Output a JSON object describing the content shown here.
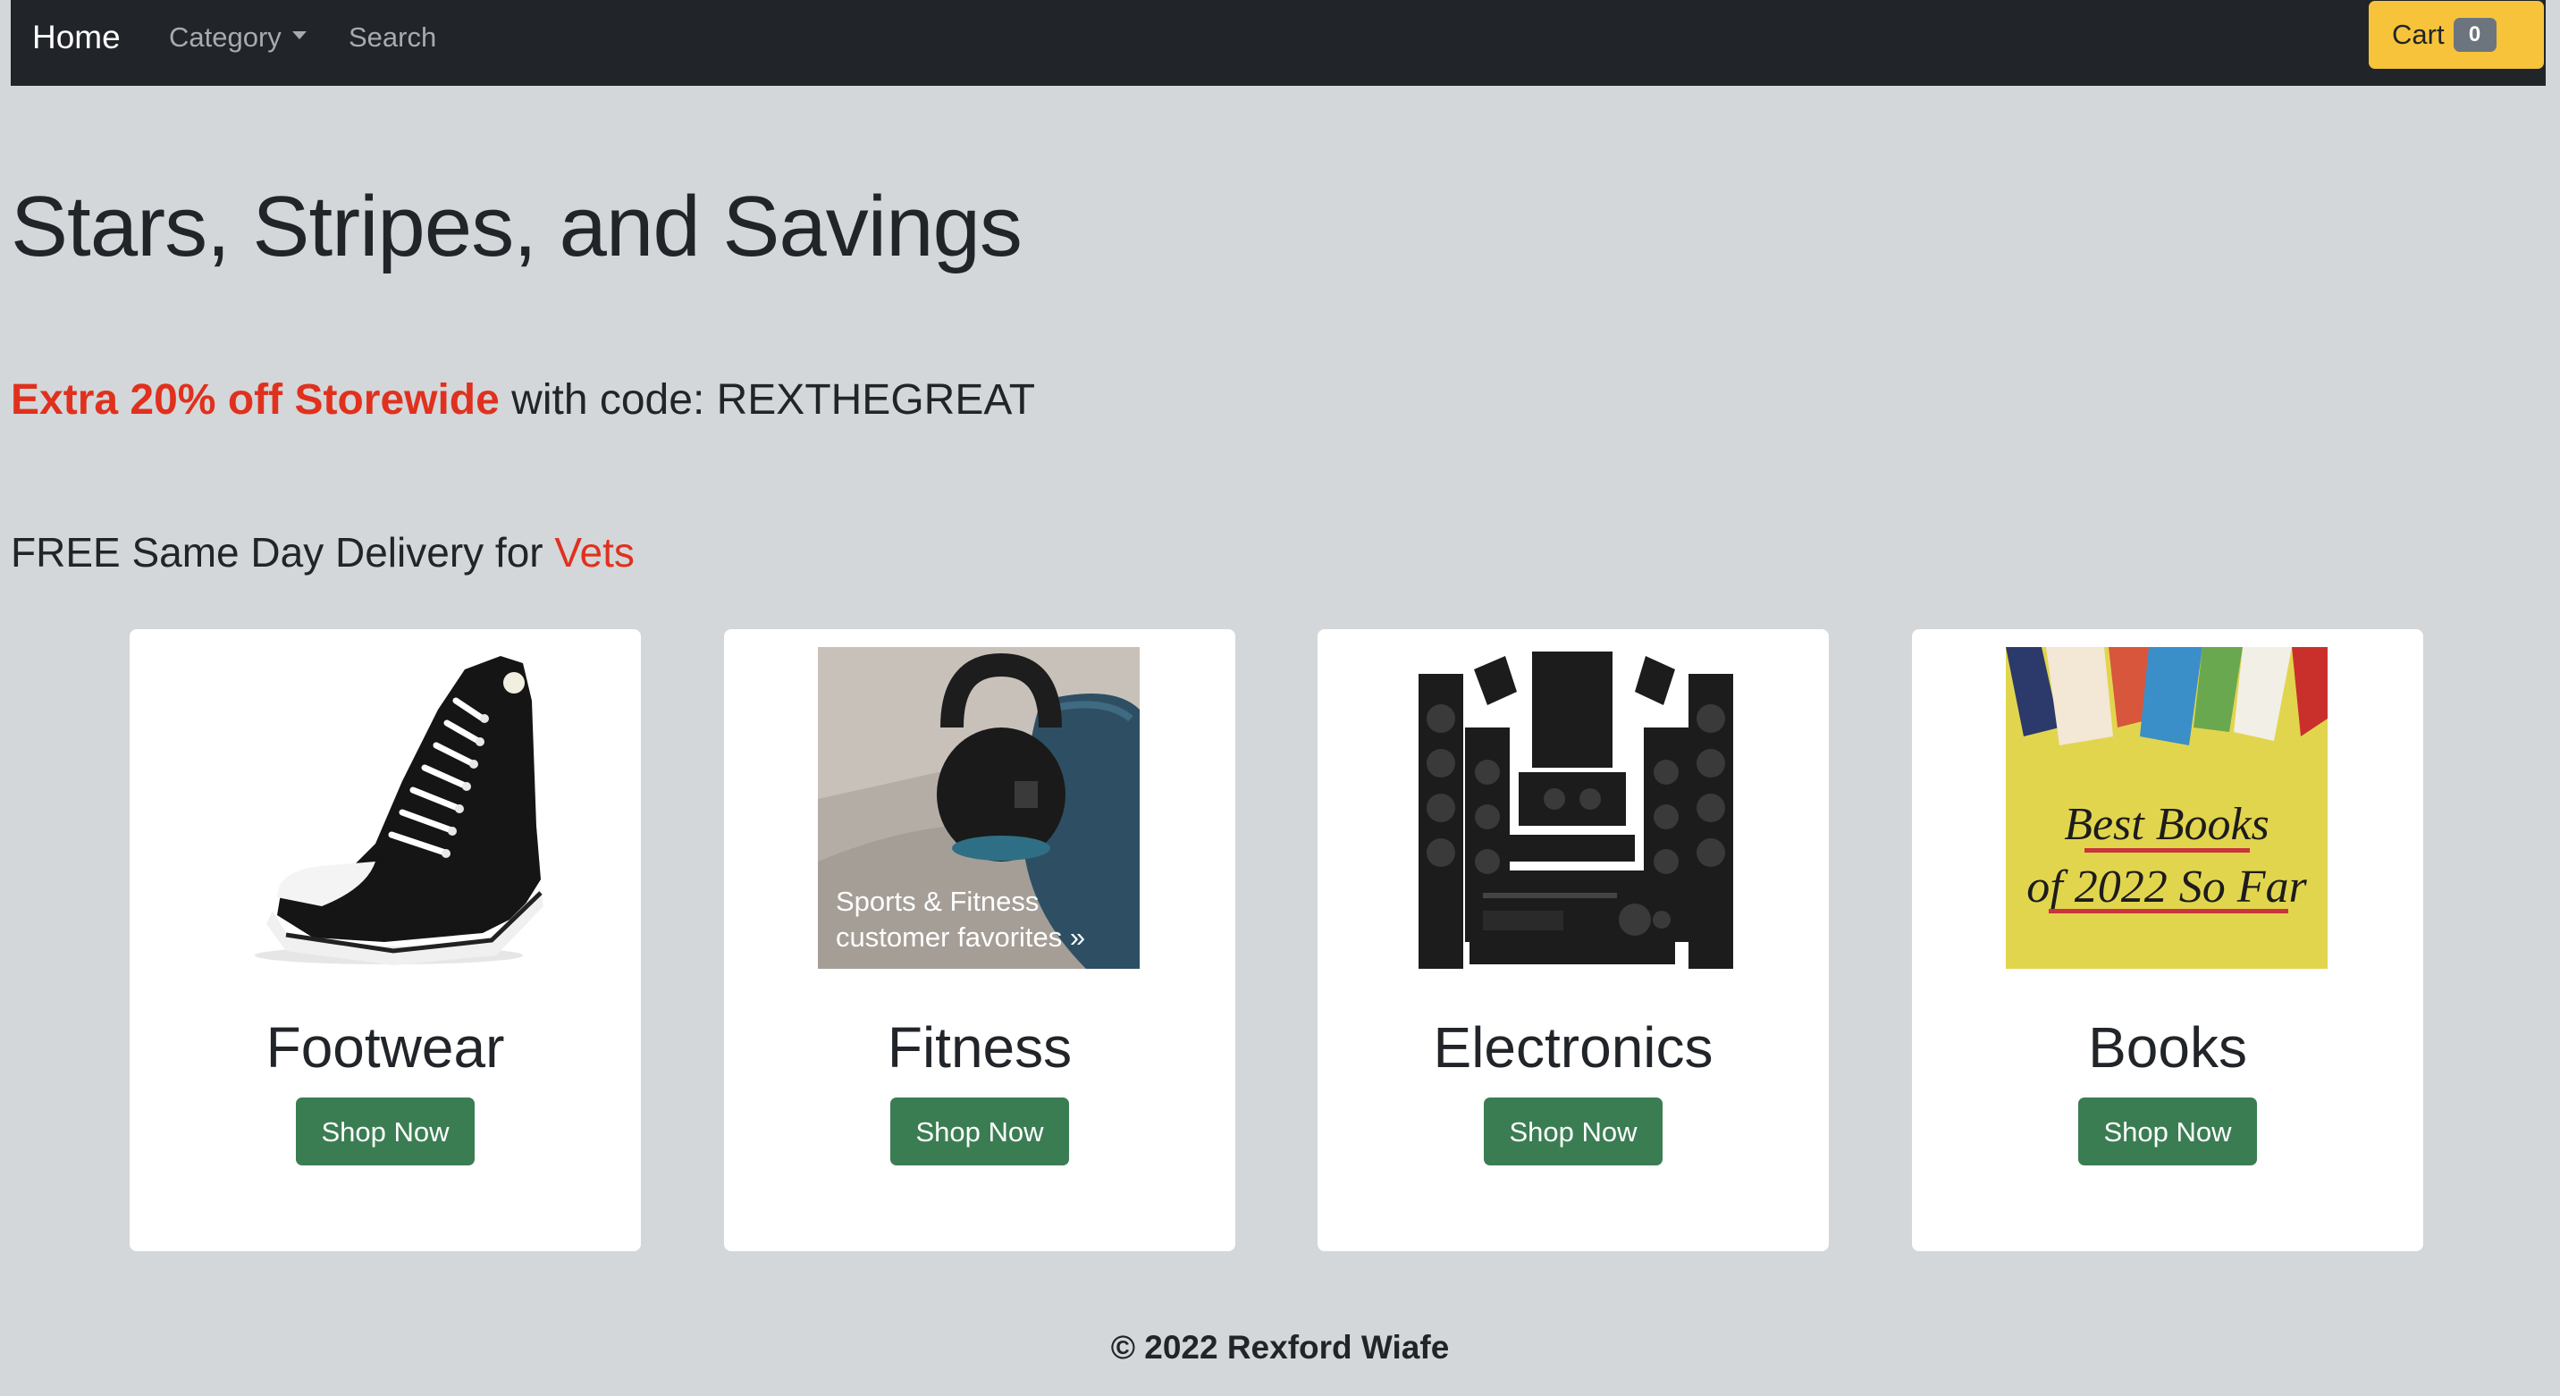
{
  "navbar": {
    "brand": "Home",
    "category_label": "Category",
    "search_label": "Search",
    "cart_label": "Cart",
    "cart_count": "0"
  },
  "hero": {
    "title": "Stars, Stripes, and Savings",
    "promo_highlight": "Extra 20% off Storewide",
    "promo_rest": " with code: REXTHEGREAT",
    "delivery_text": "FREE Same Day Delivery for ",
    "delivery_highlight": "Vets"
  },
  "cards": [
    {
      "title": "Footwear",
      "button": "Shop Now",
      "image": "sneaker-image"
    },
    {
      "title": "Fitness",
      "button": "Shop Now",
      "image": "kettlebell-image",
      "image_caption_1": "Sports & Fitness",
      "image_caption_2": "customer favorites »"
    },
    {
      "title": "Electronics",
      "button": "Shop Now",
      "image": "home-theater-image"
    },
    {
      "title": "Books",
      "button": "Shop Now",
      "image": "books-banner-image",
      "image_caption_1": "Best Books",
      "image_caption_2": "of 2022 So Far"
    }
  ],
  "colors": {
    "background": "#d3d7d9",
    "navbar": "#212529",
    "cart_button": "#f6c33a",
    "accent_red": "#e0311e",
    "shop_button": "#3b7d53"
  },
  "footer": {
    "text": "© 2022 Rexford Wiafe"
  }
}
